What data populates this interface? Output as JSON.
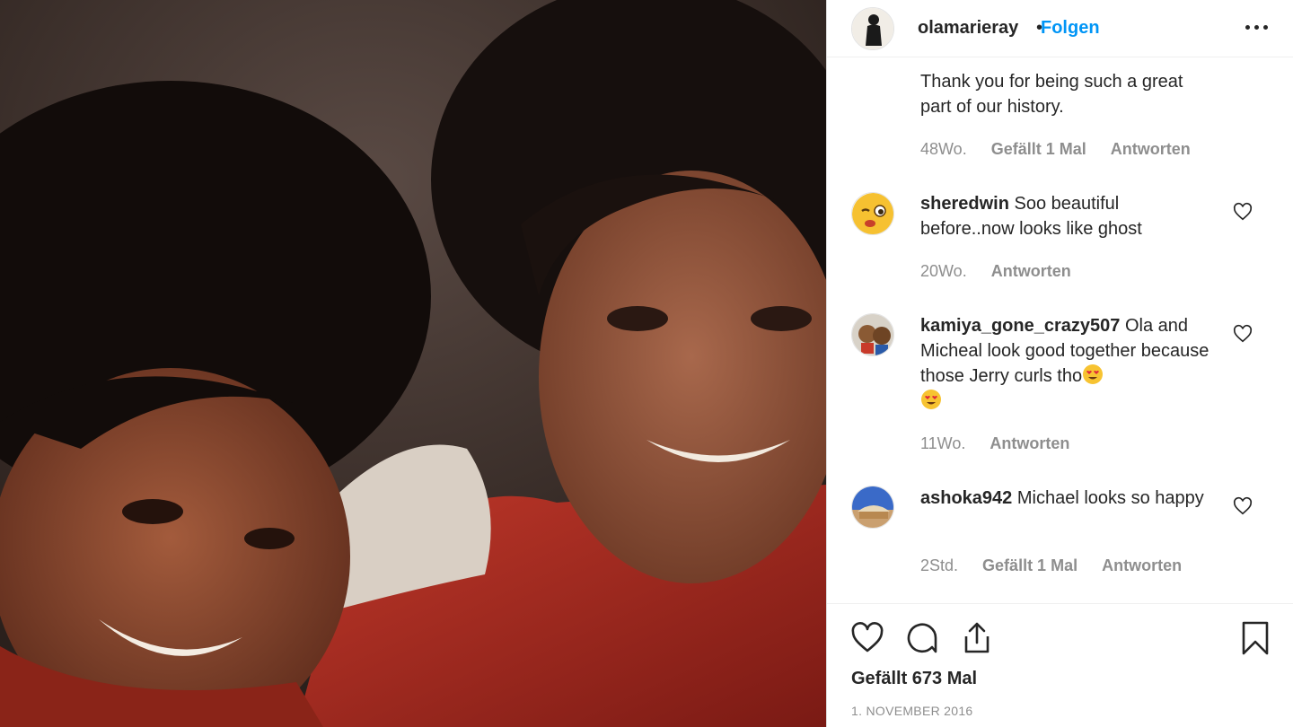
{
  "post": {
    "username": "olamarieray",
    "separator": "•",
    "follow_label": "Folgen",
    "more_icon": "more-options-icon",
    "photo_alt": "photo"
  },
  "comments": [
    {
      "username": "",
      "text": "Thank you for being such a great part of our history.",
      "time": "48Wo.",
      "likes": "Gefällt 1 Mal",
      "reply": "Antworten"
    },
    {
      "username": "sheredwin",
      "text": "Soo beautiful before..now looks like ghost",
      "time": "20Wo.",
      "likes": "",
      "reply": "Antworten"
    },
    {
      "username": "kamiya_gone_crazy507",
      "text": "Ola and Micheal look good together because those Jerry curls tho",
      "emojis": [
        "heart-eyes-emoji",
        "heart-eyes-emoji"
      ],
      "time": "11Wo.",
      "likes": "",
      "reply": "Antworten"
    },
    {
      "username": "ashoka942",
      "text": "Michael looks so happy",
      "time": "2Std.",
      "likes": "Gefällt 1 Mal",
      "reply": "Antworten"
    }
  ],
  "actions": {
    "icons": [
      "heart-icon",
      "comment-icon",
      "share-icon",
      "bookmark-icon"
    ],
    "likes_count": "Gefällt 673 Mal",
    "date": "1. NOVEMBER 2016"
  },
  "colors": {
    "accent": "#0095f6",
    "text": "#262626",
    "muted": "#8e8e8e",
    "border": "#dbdbdb"
  }
}
